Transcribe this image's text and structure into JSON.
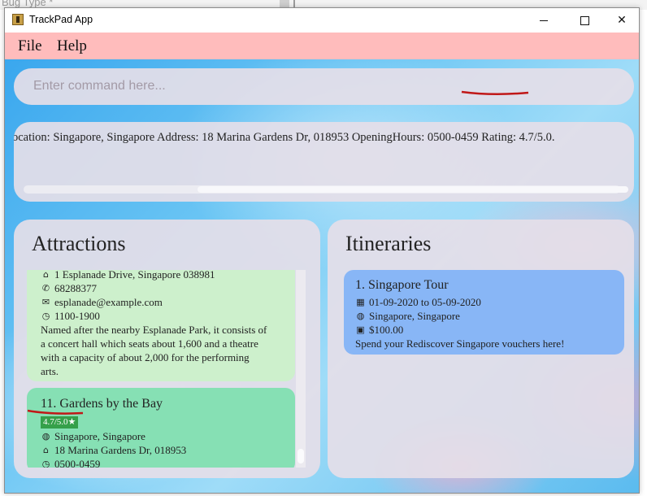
{
  "background_window": {
    "partial_text": "Bug Type *"
  },
  "window": {
    "title": "TrackPad App",
    "controls": {
      "minimize": "minimize",
      "maximize": "maximize",
      "close": "✕"
    }
  },
  "menu": {
    "file": "File",
    "help": "Help"
  },
  "command": {
    "placeholder": "Enter command here...",
    "value": ""
  },
  "result": {
    "text": "ocation: Singapore, Singapore Address: 18 Marina Gardens Dr, 018953 OpeningHours: 0500-0459 Rating: 4.7/5.0."
  },
  "attractions": {
    "title": "Attractions",
    "items": [
      {
        "address": "1 Esplanade Drive, Singapore 038981",
        "phone": "68288377",
        "email": "esplanade@example.com",
        "hours": "1100-1900",
        "description": "Named after the nearby Esplanade Park, it consists of a concert hall which seats about 1,600 and a theatre with a capacity of about 2,000 for the performing arts."
      },
      {
        "index": "11.",
        "name": "Gardens by the Bay",
        "rating": "4.7/5.0★",
        "location": "Singapore, Singapore",
        "address": "18 Marina Gardens Dr, 018953",
        "hours": "0500-0459"
      }
    ]
  },
  "itineraries": {
    "title": "Itineraries",
    "items": [
      {
        "index": "1.",
        "name": "Singapore Tour",
        "dates": "01-09-2020 to 05-09-2020",
        "location": "Singapore, Singapore",
        "budget": "$100.00",
        "description": "Spend your Rediscover Singapore vouchers here!"
      }
    ]
  },
  "colors": {
    "menubar": "#ffbcbc",
    "attraction_card_dim": "#cdf0cc",
    "attraction_card_selected": "#86e0b4",
    "itinerary_card": "#88b6f6",
    "rating_badge": "#35a04a",
    "annotation": "#c01818"
  },
  "icons": {
    "home": "home-icon",
    "phone": "phone-icon",
    "email": "email-icon",
    "clock": "clock-icon",
    "globe": "globe-icon",
    "calendar": "calendar-icon",
    "money": "money-icon"
  }
}
